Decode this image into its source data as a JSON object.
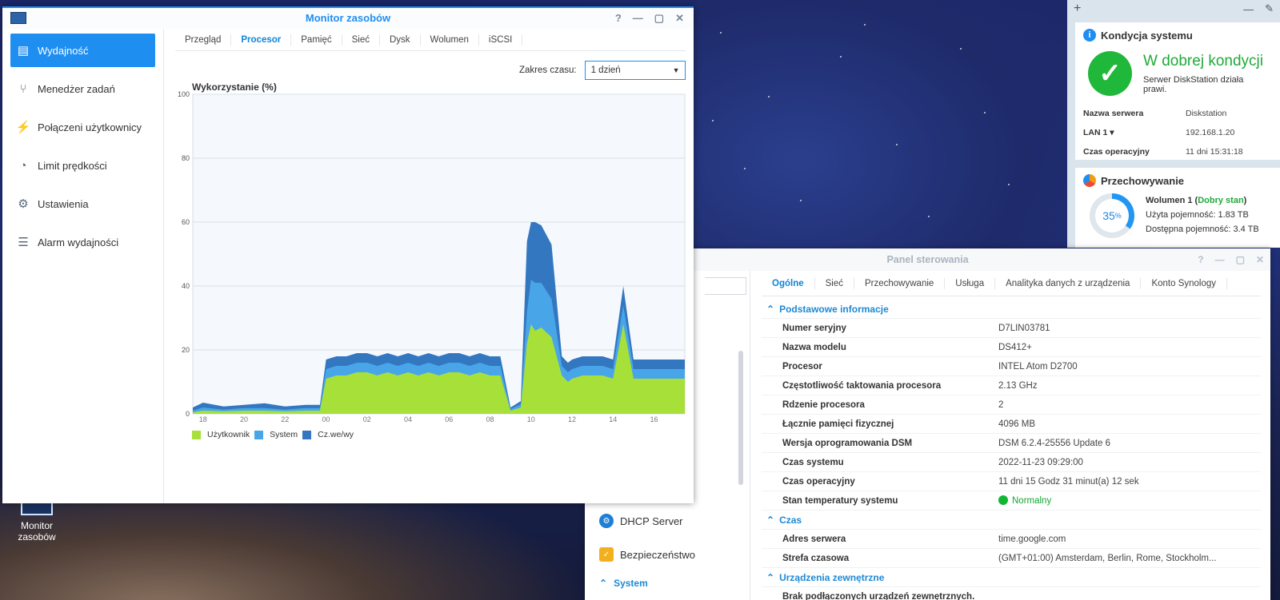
{
  "desktop": {
    "icon_label_1": "Monitor",
    "icon_label_2": "zasobów"
  },
  "widgets": {
    "health": {
      "title": "Kondycja systemu",
      "status": "W dobrej kondycji",
      "message": "Serwer DiskStation działa prawi.",
      "rows": [
        {
          "k": "Nazwa serwera",
          "v": "Diskstation"
        },
        {
          "k": "LAN 1 ▾",
          "v": "192.168.1.20"
        },
        {
          "k": "Czas operacyjny",
          "v": "11 dni 15:31:18"
        }
      ]
    },
    "storage": {
      "title": "Przechowywanie",
      "percent": "35",
      "percent_sign": "%",
      "volume": "Wolumen 1 (",
      "volume_status": "Dobry stan",
      "volume_end": ")",
      "used": "Użyta pojemność: 1.83 TB",
      "free": "Dostępna pojemność: 3.4 TB",
      "used_fraction": 0.35
    }
  },
  "control_panel": {
    "title": "Panel sterowania",
    "tabs": [
      "Ogólne",
      "Sieć",
      "Przechowywanie",
      "Usługa",
      "Analityka danych z urządzenia",
      "Konto Synology"
    ],
    "nav": [
      {
        "label": "DHCP Server",
        "icon": "dhcp-icon"
      },
      {
        "label": "Bezpieczeństwo",
        "icon": "shield-icon"
      },
      {
        "label": "System",
        "icon": "chevron-up-icon"
      }
    ],
    "sections": [
      {
        "title": "Podstawowe informacje",
        "rows": [
          {
            "k": "Numer seryjny",
            "v": "D7LIN03781"
          },
          {
            "k": "Nazwa modelu",
            "v": "DS412+"
          },
          {
            "k": "Procesor",
            "v": "INTEL Atom D2700"
          },
          {
            "k": "Częstotliwość taktowania procesora",
            "v": "2.13 GHz"
          },
          {
            "k": "Rdzenie procesora",
            "v": "2"
          },
          {
            "k": "Łącznie pamięci fizycznej",
            "v": "4096 MB"
          },
          {
            "k": "Wersja oprogramowania DSM",
            "v": "DSM 6.2.4-25556 Update 6"
          },
          {
            "k": "Czas systemu",
            "v": "2022-11-23 09:29:00"
          },
          {
            "k": "Czas operacyjny",
            "v": "11 dni 15 Godz 31 minut(a) 12 sek"
          },
          {
            "k": "Stan temperatury systemu",
            "v": "Normalny"
          }
        ]
      },
      {
        "title": "Czas",
        "rows": [
          {
            "k": "Adres serwera",
            "v": "time.google.com"
          },
          {
            "k": "Strefa czasowa",
            "v": "(GMT+01:00) Amsterdam, Berlin, Rome, Stockholm..."
          }
        ]
      },
      {
        "title": "Urządzenia zewnętrzne",
        "rows": [
          {
            "k": "Brak podłączonych urządzeń zewnętrznych.",
            "v": ""
          }
        ]
      }
    ]
  },
  "monitor": {
    "title": "Monitor zasobów",
    "nav": [
      {
        "label": "Wydajność",
        "icon": "performance-icon"
      },
      {
        "label": "Menedżer zadań",
        "icon": "task-manager-icon"
      },
      {
        "label": "Połączeni użytkownicy",
        "icon": "plug-icon"
      },
      {
        "label": "Limit prędkości",
        "icon": "speed-limit-icon"
      },
      {
        "label": "Ustawienia",
        "icon": "gear-icon"
      },
      {
        "label": "Alarm wydajności",
        "icon": "list-alarm-icon"
      }
    ],
    "tabs": [
      "Przegląd",
      "Procesor",
      "Pamięć",
      "Sieć",
      "Dysk",
      "Wolumen",
      "iSCSI"
    ],
    "active_tab": "Procesor",
    "range_label": "Zakres czasu:",
    "range_value": "1 dzień"
  },
  "chart_data": {
    "type": "area",
    "title": "Wykorzystanie (%)",
    "ylim": [
      0,
      100
    ],
    "yticks": [
      0,
      20,
      40,
      60,
      80,
      100
    ],
    "xticks": [
      "18",
      "20",
      "22",
      "00",
      "02",
      "04",
      "06",
      "08",
      "10",
      "12",
      "14",
      "16"
    ],
    "x_start_hour": 17.5,
    "x_end_hour": 41.5,
    "legend": [
      {
        "name": "Użytkownik",
        "color": "#a8e03a"
      },
      {
        "name": "System",
        "color": "#48a6e8"
      },
      {
        "name": "Cz.we/wy",
        "color": "#3377c0"
      }
    ],
    "stacked": true,
    "x_hours": [
      17.5,
      18,
      19,
      20,
      21,
      22,
      23,
      23.7,
      24,
      24.5,
      25,
      25.5,
      26,
      26.5,
      27,
      27.5,
      28,
      28.5,
      29,
      29.5,
      30,
      30.5,
      31,
      31.5,
      32,
      32.5,
      33,
      33.5,
      33.8,
      34,
      34.2,
      34.5,
      35,
      35.5,
      35.8,
      36,
      36.5,
      37,
      37.5,
      38,
      38.5,
      39,
      39.5,
      40,
      40.5,
      41,
      41.5
    ],
    "series": [
      {
        "name": "Użytkownik",
        "values": [
          0.5,
          1,
          0.8,
          1,
          1,
          0.8,
          1,
          1,
          11,
          12,
          12,
          13,
          13,
          12,
          13,
          12,
          13,
          12,
          13,
          12,
          13,
          13,
          12,
          13,
          12,
          12,
          1,
          2,
          22,
          28,
          26,
          27,
          24,
          12,
          10,
          11,
          12,
          12,
          12,
          11,
          28,
          11,
          11,
          11,
          11,
          11,
          11
        ]
      },
      {
        "name": "System",
        "values": [
          0.5,
          1,
          0.5,
          0.8,
          0.8,
          0.5,
          0.8,
          0.8,
          3,
          3,
          3,
          3,
          3,
          3,
          3,
          3,
          3,
          3,
          3,
          3,
          3,
          3,
          3,
          3,
          3,
          3,
          0.5,
          1,
          10,
          14,
          15,
          14,
          12,
          3,
          3,
          3,
          3,
          3,
          3,
          3,
          6,
          3,
          3,
          3,
          3,
          3,
          3
        ]
      },
      {
        "name": "Cz.we/wy",
        "values": [
          1,
          1.5,
          1,
          1,
          1.5,
          1,
          1,
          1,
          3,
          3,
          3,
          3,
          3,
          3,
          3,
          3,
          3,
          3,
          3,
          3,
          3,
          3,
          3,
          3,
          3,
          3,
          0.5,
          1,
          22,
          18,
          19,
          18,
          17,
          3,
          3,
          3,
          3,
          3,
          3,
          3,
          6,
          3,
          3,
          3,
          3,
          3,
          3
        ]
      }
    ]
  },
  "colors": {
    "accent": "#1f8ef1",
    "ok": "#20b83b"
  }
}
